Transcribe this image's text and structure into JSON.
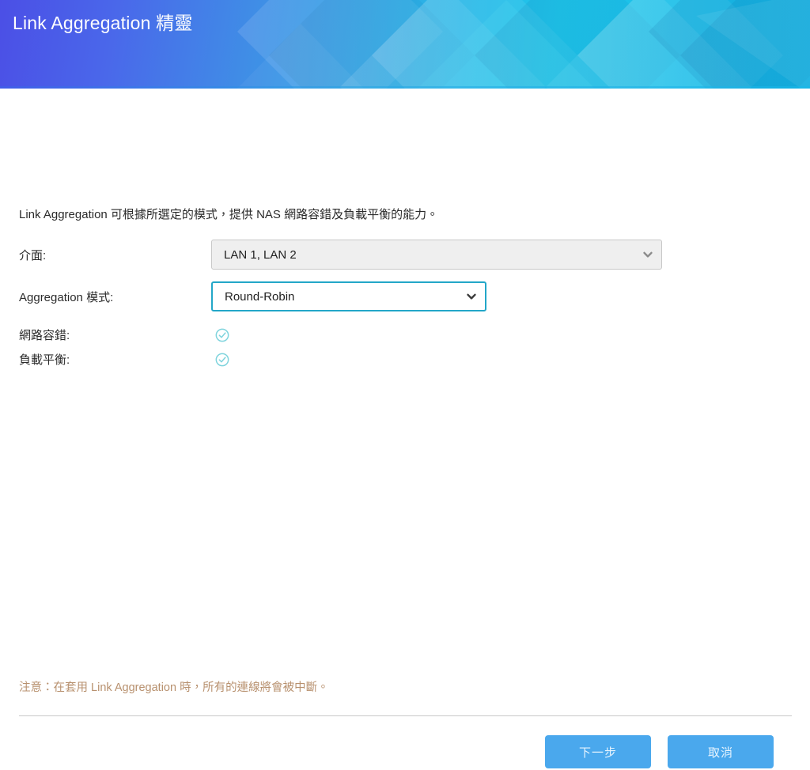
{
  "header": {
    "title": "Link Aggregation 精靈",
    "gradient_start": "#4b4fe6",
    "gradient_end": "#16b7e6"
  },
  "main": {
    "description": "Link Aggregation 可根據所選定的模式，提供 NAS 網路容錯及負載平衡的能力。",
    "fields": [
      {
        "label": "介面:",
        "value": "LAN 1, LAN 2",
        "state": "disabled",
        "icon": "chevron-down-icon"
      },
      {
        "label": "Aggregation 模式:",
        "value": "Round-Robin",
        "state": "focused",
        "icon": "chevron-down-icon"
      }
    ],
    "capabilities": [
      {
        "label": "網路容錯:",
        "icon": "check-circle-icon",
        "enabled": true
      },
      {
        "label": "負載平衡:",
        "icon": "check-circle-icon",
        "enabled": true
      }
    ],
    "check_color": "#7fd4dd",
    "note": "注意：在套用 Link Aggregation 時，所有的連線將會被中斷。",
    "note_color": "#b8916f"
  },
  "footer": {
    "next_label": "下一步",
    "cancel_label": "取消",
    "button_color": "#4aa8ed"
  }
}
